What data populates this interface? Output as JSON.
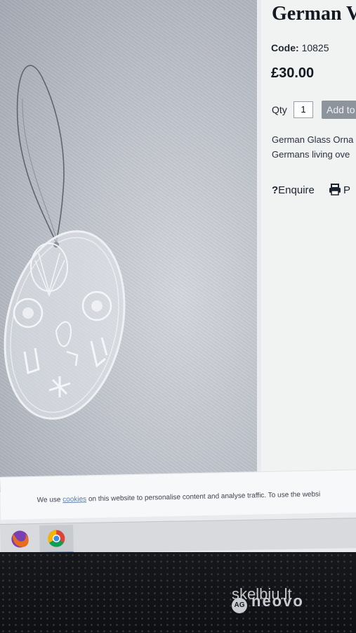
{
  "product": {
    "title": "German V",
    "code_label": "Code:",
    "code_value": "10825",
    "price": "£30.00",
    "qty_label": "Qty",
    "qty_value": "1",
    "add_button": "Add to",
    "description_lines": [
      "German Glass Orna",
      "Germans living ove"
    ],
    "enquire_label": "Enquire",
    "print_label": "P"
  },
  "cookie_banner": {
    "prefix": "We use",
    "link": "cookies",
    "suffix": "on this website to personalise content and analyse traffic. To use the websi"
  },
  "taskbar": {
    "apps": [
      {
        "icon": "firefox-icon",
        "color": "#e86c1e"
      },
      {
        "icon": "chrome-icon",
        "color": "#3b8eea"
      }
    ]
  },
  "monitor": {
    "brand": "neovo",
    "brand_badge": "AG"
  },
  "watermark": {
    "text": "skelbiu.lt"
  }
}
